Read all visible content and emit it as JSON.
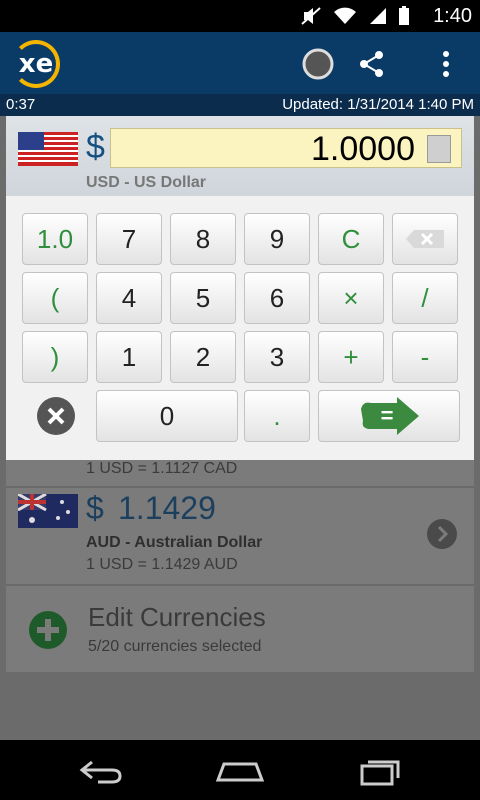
{
  "status_bar": {
    "time": "1:40"
  },
  "app_bar": {
    "logo_text": "xe"
  },
  "info_bar": {
    "left_text": "0:37",
    "updated_text": "Updated: 1/31/2014 1:40 PM"
  },
  "amount": {
    "symbol": "$",
    "value": "1.0000",
    "currency_name": "USD - US Dollar"
  },
  "keypad": {
    "row1": [
      "1.0",
      "7",
      "8",
      "9",
      "C"
    ],
    "row2": [
      "(",
      "4",
      "5",
      "6",
      "×",
      "/"
    ],
    "row3": [
      ")",
      "1",
      "2",
      "3",
      "+",
      "-"
    ],
    "row4": [
      "0",
      ".",
      "="
    ]
  },
  "background_rows": {
    "cad_rate": "1 USD = 1.1127 CAD",
    "aud_symbol": "$",
    "aud_value": "1.1429",
    "aud_name": "AUD - Australian Dollar",
    "aud_rate": "1 USD = 1.1429 AUD",
    "edit_title": "Edit Currencies",
    "edit_sub": "5/20 currencies selected"
  },
  "colors": {
    "app_bar": "#0a3a66",
    "amount_bg": "#fbf3c0",
    "green": "#2f8f3c"
  }
}
